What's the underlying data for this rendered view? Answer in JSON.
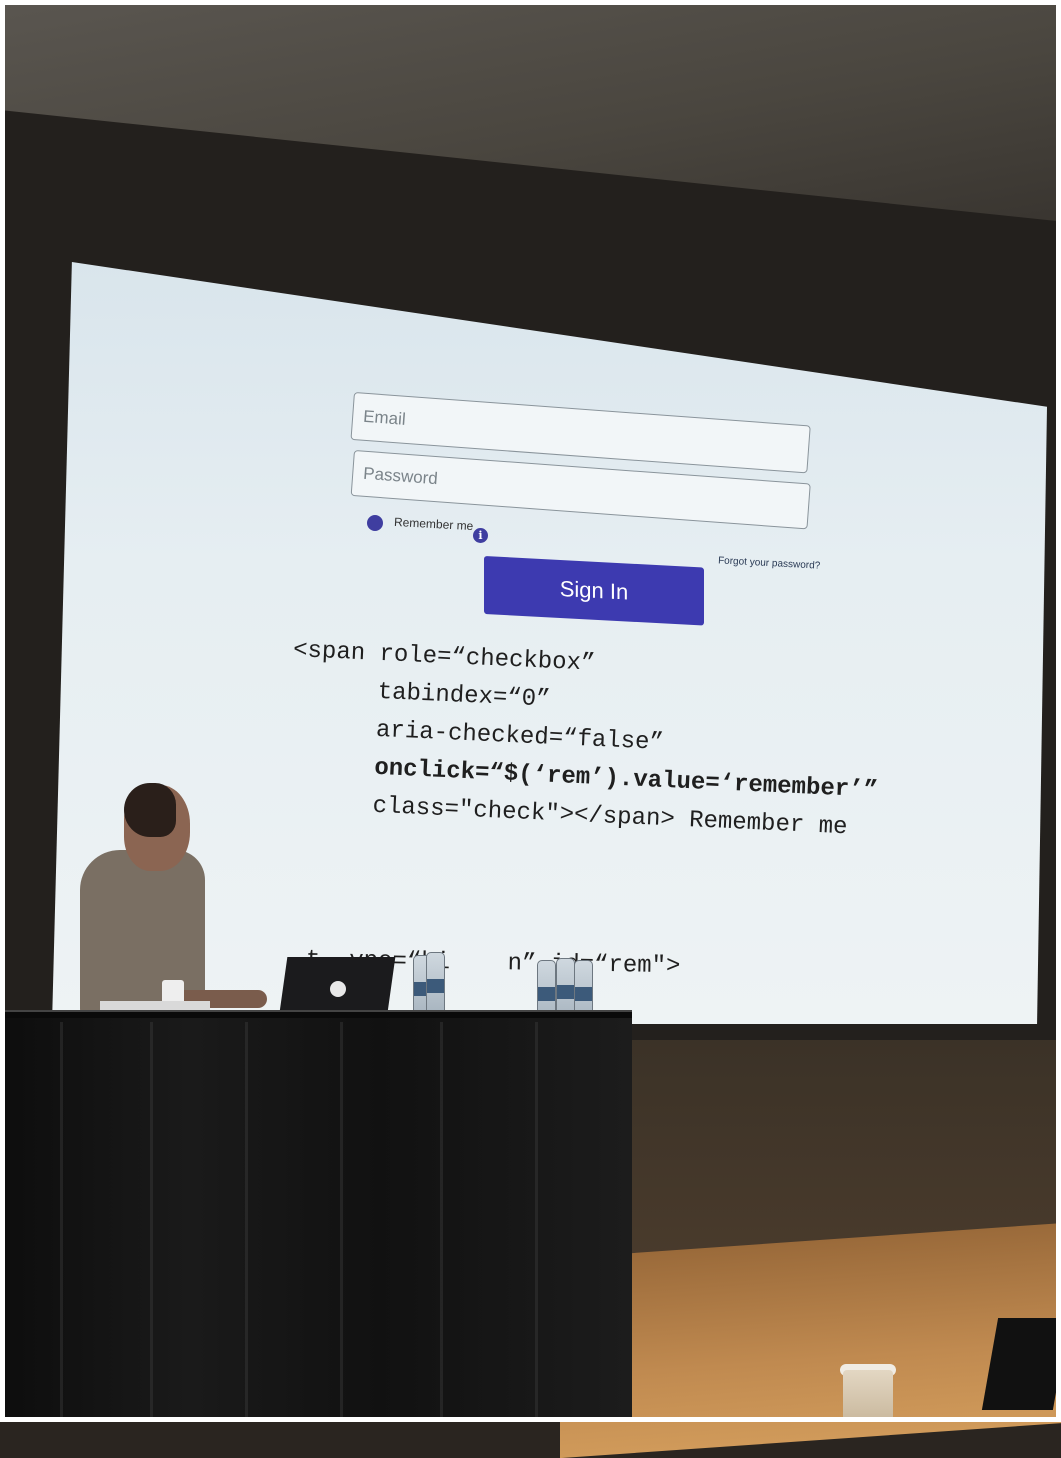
{
  "login_form": {
    "email_placeholder": "Email",
    "password_placeholder": "Password",
    "remember_label": "Remember me",
    "info_icon": "i",
    "forgot_link": "Forgot your password?",
    "signin_label": "Sign In"
  },
  "code_snippet": {
    "line1": "<span role=“checkbox”",
    "line2": "      tabindex=“0”",
    "line3": "      aria-checked=“false”",
    "line4": "      onclick=“$(‘rem’).value=‘remember’”",
    "line5": "      class=\"check\"></span> Remember me",
    "partial_line": "t  ype=“hi    n” id=“rem\">"
  },
  "colors": {
    "accent": "#3d3ab0",
    "screen": "#e6eef2"
  }
}
